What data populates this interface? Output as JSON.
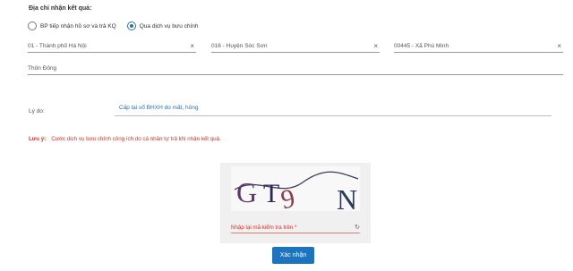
{
  "section_title": "Địa chỉ nhận kết quả:",
  "delivery_options": [
    {
      "label": "BP tiếp nhận hồ sơ và trả KQ",
      "checked": false
    },
    {
      "label": "Qua dịch vụ bưu chính",
      "checked": true
    }
  ],
  "address": {
    "province": "01 - Thành phố Hà Nội",
    "district": "016 - Huyện Sóc Sơn",
    "ward": "00445 - Xã Phù Minh",
    "clear_glyph": "×",
    "street": "Thôn Đông"
  },
  "reason": {
    "label": "Lý do:",
    "value": "Cấp lại sổ BHXH do mất, hỏng"
  },
  "note": {
    "label": "Lưu ý:",
    "text": "Cước dịch vụ bưu chính công ích do cá nhân tự trả khi nhận kết quả."
  },
  "captcha": {
    "chars": [
      "G",
      "T",
      "9",
      "N"
    ],
    "placeholder": "Nhập lại mã kiểm tra trên *",
    "refresh_glyph": "↻"
  },
  "submit_label": "Xác nhận",
  "colors": {
    "accent": "#1e73be",
    "warning": "#d9342b"
  }
}
